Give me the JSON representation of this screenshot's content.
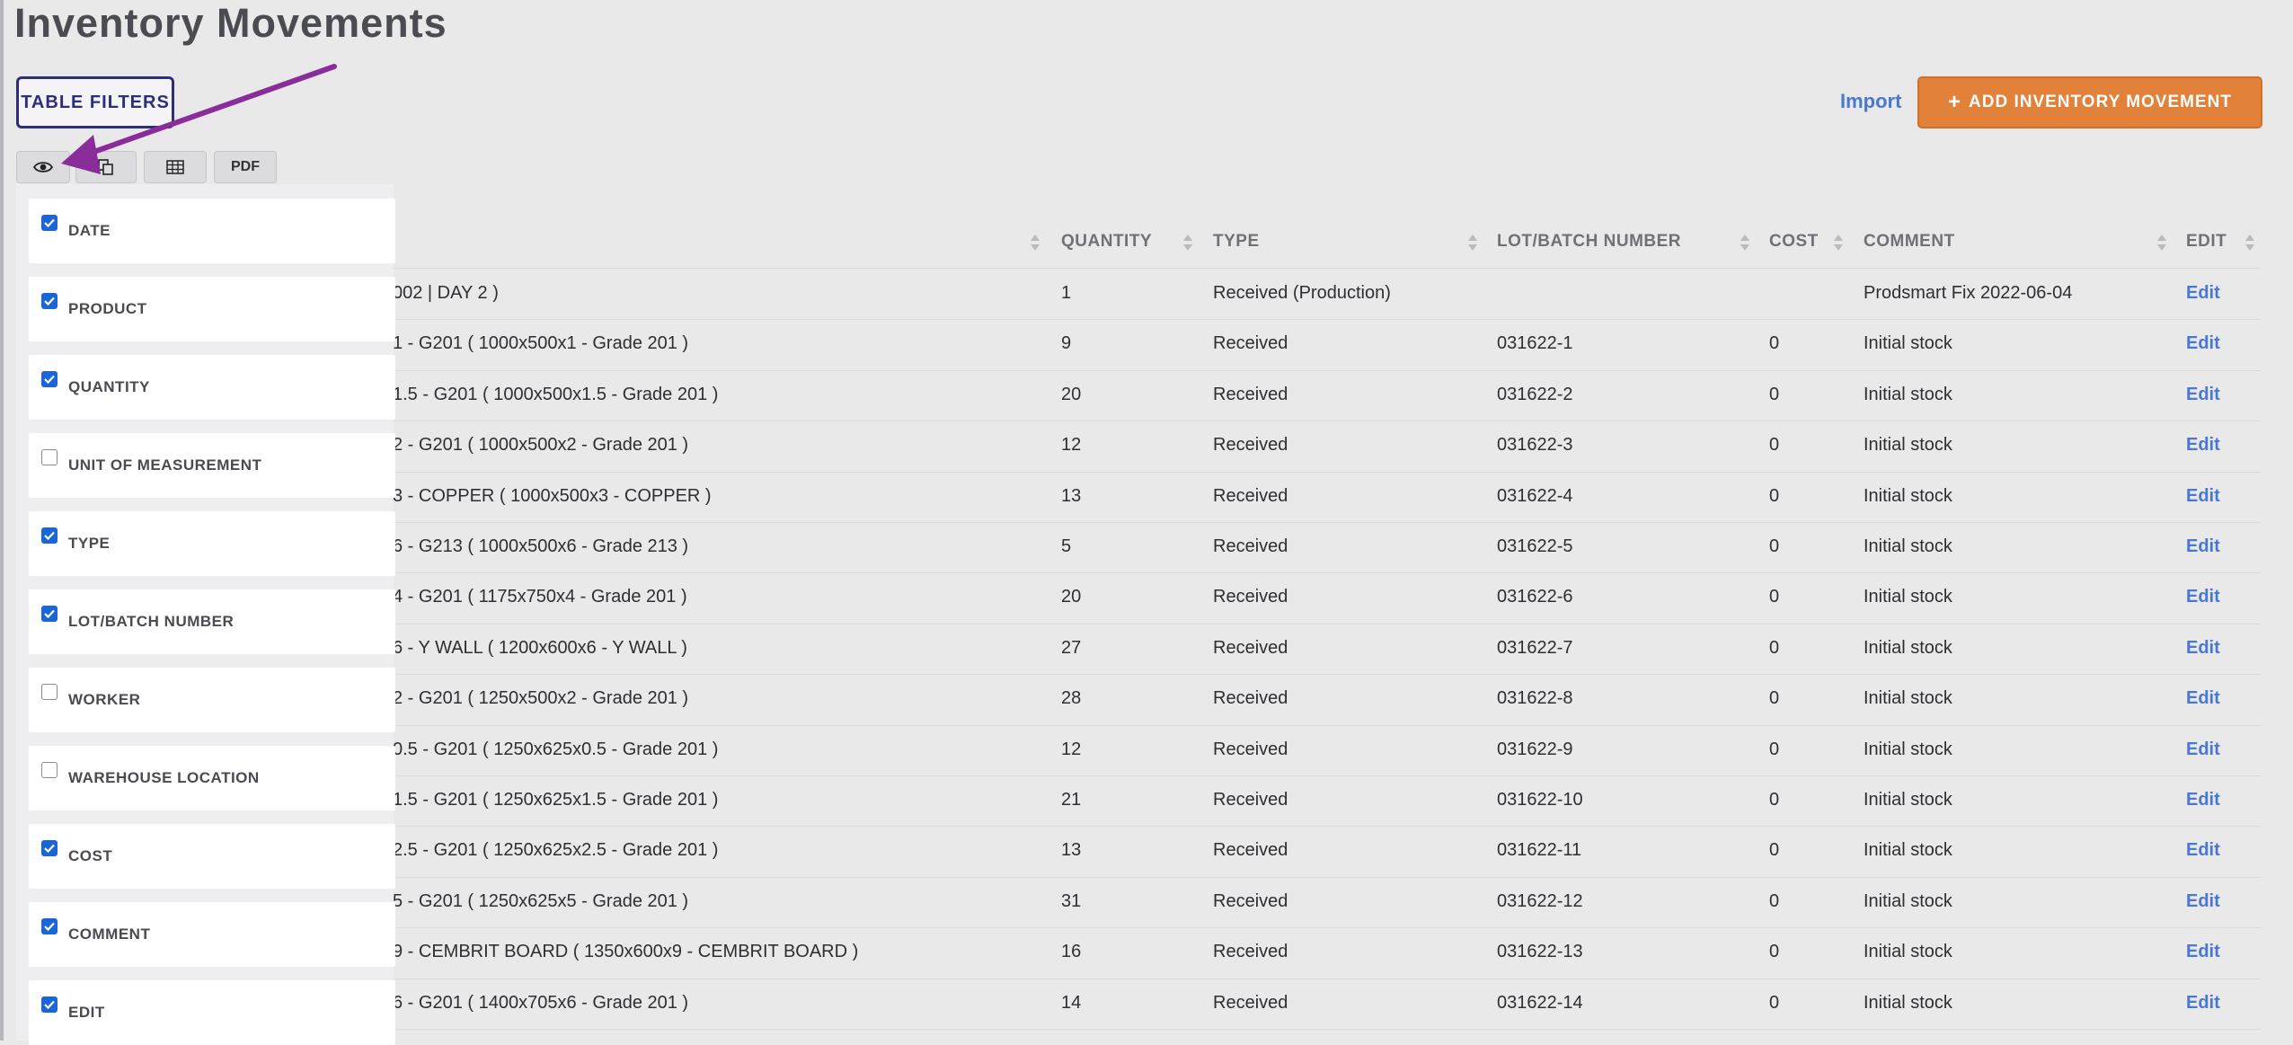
{
  "page": {
    "title": "Inventory Movements"
  },
  "toolbar": {
    "table_filters_label": "TABLE FILTERS",
    "import_label": "Import",
    "add_icon": "plus-icon",
    "add_label": "ADD INVENTORY MOVEMENT",
    "pdf_label": "PDF",
    "accent_color": "#e2823a",
    "link_color": "#4a78d0"
  },
  "columns": {
    "quantity": "QUANTITY",
    "type": "TYPE",
    "lot": "LOT/BATCH NUMBER",
    "cost": "COST",
    "comment": "COMMENT",
    "edit": "EDIT"
  },
  "column_toggle": {
    "items": [
      {
        "label": "DATE",
        "checked": true
      },
      {
        "label": "PRODUCT",
        "checked": true
      },
      {
        "label": "QUANTITY",
        "checked": true
      },
      {
        "label": "UNIT OF MEASUREMENT",
        "checked": false
      },
      {
        "label": "TYPE",
        "checked": true
      },
      {
        "label": "LOT/BATCH NUMBER",
        "checked": true
      },
      {
        "label": "WORKER",
        "checked": false
      },
      {
        "label": "WAREHOUSE LOCATION",
        "checked": false
      },
      {
        "label": "COST",
        "checked": true
      },
      {
        "label": "COMMENT",
        "checked": true
      },
      {
        "label": "EDIT",
        "checked": true
      }
    ]
  },
  "rows": [
    {
      "product": "002 | DAY 2 )",
      "quantity": "1",
      "type": "Received (Production)",
      "lot": "",
      "cost": "",
      "comment": "Prodsmart Fix 2022-06-04",
      "edit": "Edit"
    },
    {
      "product": "1 - G201 ( 1000x500x1 - Grade 201 )",
      "quantity": "9",
      "type": "Received",
      "lot": "031622-1",
      "cost": "0",
      "comment": "Initial stock",
      "edit": "Edit"
    },
    {
      "product": "1.5 - G201 ( 1000x500x1.5 - Grade 201 )",
      "quantity": "20",
      "type": "Received",
      "lot": "031622-2",
      "cost": "0",
      "comment": "Initial stock",
      "edit": "Edit"
    },
    {
      "product": "2 - G201 ( 1000x500x2 - Grade 201 )",
      "quantity": "12",
      "type": "Received",
      "lot": "031622-3",
      "cost": "0",
      "comment": "Initial stock",
      "edit": "Edit"
    },
    {
      "product": "3 - COPPER ( 1000x500x3 - COPPER )",
      "quantity": "13",
      "type": "Received",
      "lot": "031622-4",
      "cost": "0",
      "comment": "Initial stock",
      "edit": "Edit"
    },
    {
      "product": "6 - G213 ( 1000x500x6 - Grade 213 )",
      "quantity": "5",
      "type": "Received",
      "lot": "031622-5",
      "cost": "0",
      "comment": "Initial stock",
      "edit": "Edit"
    },
    {
      "product": "4 - G201 ( 1175x750x4 - Grade 201 )",
      "quantity": "20",
      "type": "Received",
      "lot": "031622-6",
      "cost": "0",
      "comment": "Initial stock",
      "edit": "Edit"
    },
    {
      "product": "6 - Y WALL ( 1200x600x6 - Y WALL )",
      "quantity": "27",
      "type": "Received",
      "lot": "031622-7",
      "cost": "0",
      "comment": "Initial stock",
      "edit": "Edit"
    },
    {
      "product": "2 - G201 ( 1250x500x2 - Grade 201 )",
      "quantity": "28",
      "type": "Received",
      "lot": "031622-8",
      "cost": "0",
      "comment": "Initial stock",
      "edit": "Edit"
    },
    {
      "product": "0.5 - G201 ( 1250x625x0.5 - Grade 201 )",
      "quantity": "12",
      "type": "Received",
      "lot": "031622-9",
      "cost": "0",
      "comment": "Initial stock",
      "edit": "Edit"
    },
    {
      "product": "1.5 - G201 ( 1250x625x1.5 - Grade 201 )",
      "quantity": "21",
      "type": "Received",
      "lot": "031622-10",
      "cost": "0",
      "comment": "Initial stock",
      "edit": "Edit"
    },
    {
      "product": "2.5 - G201 ( 1250x625x2.5 - Grade 201 )",
      "quantity": "13",
      "type": "Received",
      "lot": "031622-11",
      "cost": "0",
      "comment": "Initial stock",
      "edit": "Edit"
    },
    {
      "product": "5 - G201 ( 1250x625x5 - Grade 201 )",
      "quantity": "31",
      "type": "Received",
      "lot": "031622-12",
      "cost": "0",
      "comment": "Initial stock",
      "edit": "Edit"
    },
    {
      "product": "9 - CEMBRIT BOARD ( 1350x600x9 - CEMBRIT BOARD )",
      "quantity": "16",
      "type": "Received",
      "lot": "031622-13",
      "cost": "0",
      "comment": "Initial stock",
      "edit": "Edit"
    },
    {
      "product": "6 - G201 ( 1400x705x6 - Grade 201 )",
      "quantity": "14",
      "type": "Received",
      "lot": "031622-14",
      "cost": "0",
      "comment": "Initial stock",
      "edit": "Edit"
    }
  ]
}
